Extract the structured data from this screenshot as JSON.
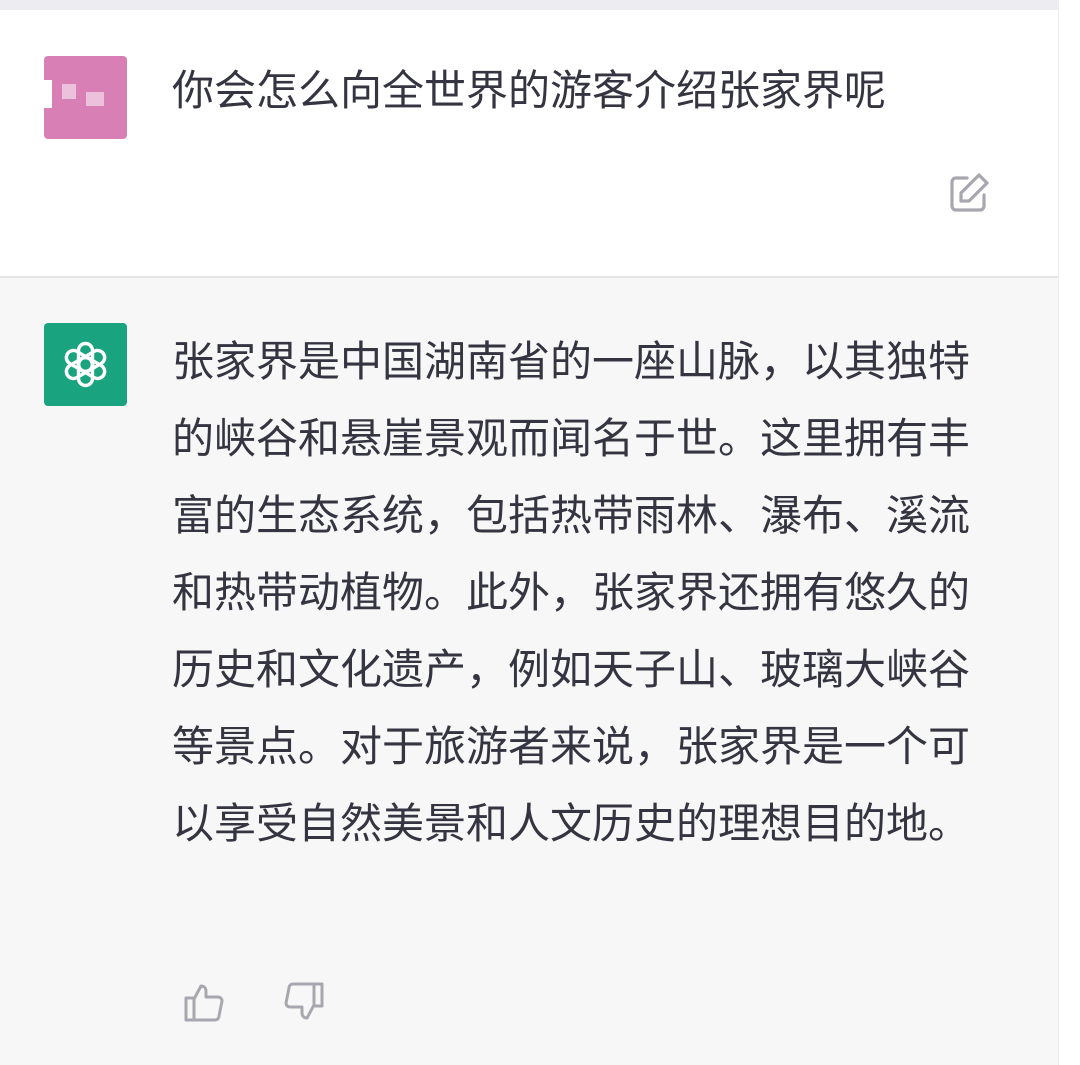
{
  "conversation": {
    "user_message": {
      "avatar": "user-avatar-pixelated",
      "text": "你会怎么向全世界的游客介绍张家界呢",
      "edit_icon": "edit-icon"
    },
    "assistant_message": {
      "avatar": "openai-logo-icon",
      "text": "张家界是中国湖南省的一座山脉，以其独特的峡谷和悬崖景观而闻名于世。这里拥有丰富的生态系统，包括热带雨林、瀑布、溪流和热带动植物。此外，张家界还拥有悠久的历史和文化遗产，例如天子山、玻璃大峡谷等景点。对于旅游者来说，张家界是一个可以享受自然美景和人文历史的理想目的地。",
      "feedback": {
        "up_icon": "thumbs-up-icon",
        "down_icon": "thumbs-down-icon"
      }
    }
  },
  "colors": {
    "user_avatar": "#d87fb5",
    "assistant_avatar": "#19a37f",
    "assistant_bg": "#f7f7f8",
    "text": "#343541"
  }
}
